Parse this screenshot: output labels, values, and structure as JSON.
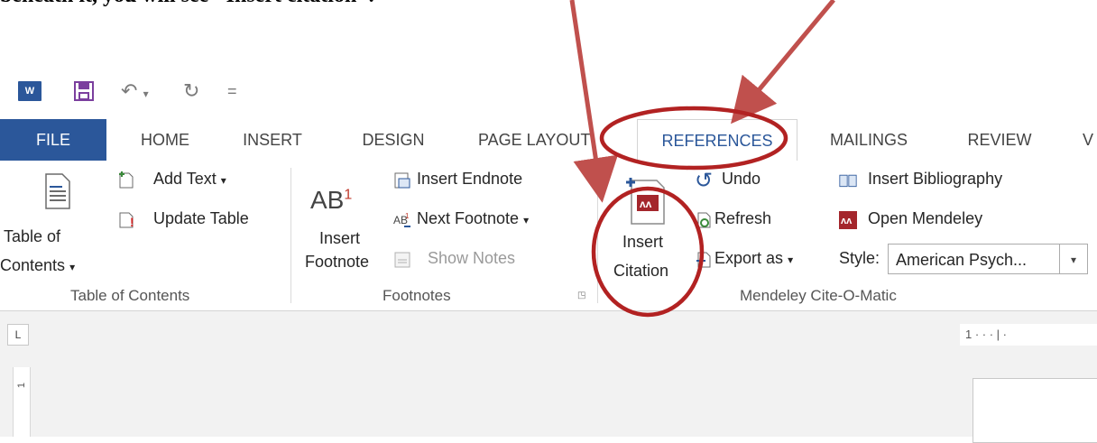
{
  "caption": "beneath it, you will see \"Insert citation\".",
  "quick_access": {
    "word_icon": "W",
    "undo_symbol": "↶",
    "redo_symbol": "↻",
    "customize_symbol": "="
  },
  "tabs": [
    {
      "label": "FILE"
    },
    {
      "label": "HOME"
    },
    {
      "label": "INSERT"
    },
    {
      "label": "DESIGN"
    },
    {
      "label": "PAGE LAYOUT"
    },
    {
      "label": "REFERENCES"
    },
    {
      "label": "MAILINGS"
    },
    {
      "label": "REVIEW"
    },
    {
      "label": "V"
    }
  ],
  "ribbon": {
    "toc": {
      "table_of_contents_line1": "Table of",
      "table_of_contents_line2": "Contents",
      "add_text": "Add Text",
      "update_table": "Update Table",
      "group_label": "Table of Contents"
    },
    "footnotes": {
      "ab_label": "AB",
      "ab_superscript": "1",
      "insert_footnote_line1": "Insert",
      "insert_footnote_line2": "Footnote",
      "insert_endnote": "Insert Endnote",
      "next_footnote": "Next Footnote",
      "show_notes": "Show Notes",
      "group_label": "Footnotes"
    },
    "mendeley": {
      "insert_citation_line1": "Insert",
      "insert_citation_line2": "Citation",
      "undo": "Undo",
      "refresh": "Refresh",
      "export_as": "Export as",
      "insert_bibliography": "Insert Bibliography",
      "open_mendeley": "Open Mendeley",
      "style_label": "Style:",
      "style_value": "American Psych...",
      "group_label": "Mendeley Cite-O-Matic"
    }
  },
  "ruler": {
    "corner": "L",
    "h_text": "1 · · · | ·",
    "v_text": "1"
  },
  "colors": {
    "word_blue": "#2b579a",
    "annotation_red": "#b22222",
    "arrow_red": "#c0504d"
  }
}
